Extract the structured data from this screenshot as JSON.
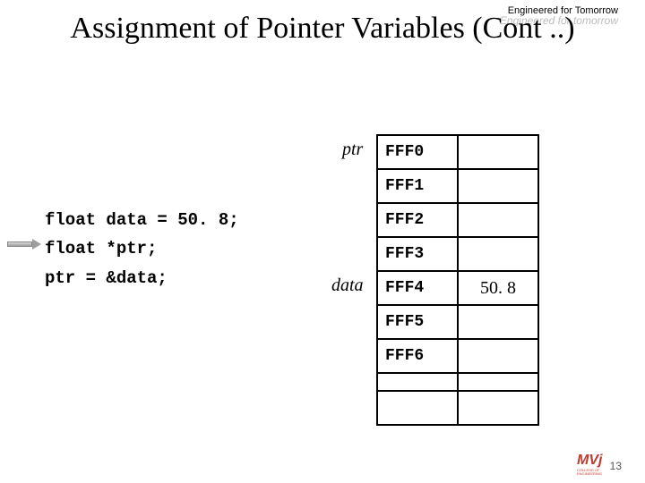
{
  "header": {
    "tagline": "Engineered for Tomorrow",
    "watermark": "Engineered for tomorrow"
  },
  "title": "Assignment of Pointer Variables (Cont ..)",
  "code": {
    "line1": "float data = 50. 8;",
    "line2": "float *ptr;",
    "line3": "ptr = &data;"
  },
  "labels": {
    "ptr": "ptr",
    "data": "data"
  },
  "memory": {
    "rows": [
      {
        "addr": "FFF0",
        "val": ""
      },
      {
        "addr": "FFF1",
        "val": ""
      },
      {
        "addr": "FFF2",
        "val": ""
      },
      {
        "addr": "FFF3",
        "val": ""
      },
      {
        "addr": "FFF4",
        "val": "50. 8"
      },
      {
        "addr": "FFF5",
        "val": ""
      },
      {
        "addr": "FFF6",
        "val": ""
      }
    ]
  },
  "footer": {
    "page": "13",
    "logo_main": "MVj",
    "logo_sub": "COLLEGE OF ENGINEERING"
  }
}
